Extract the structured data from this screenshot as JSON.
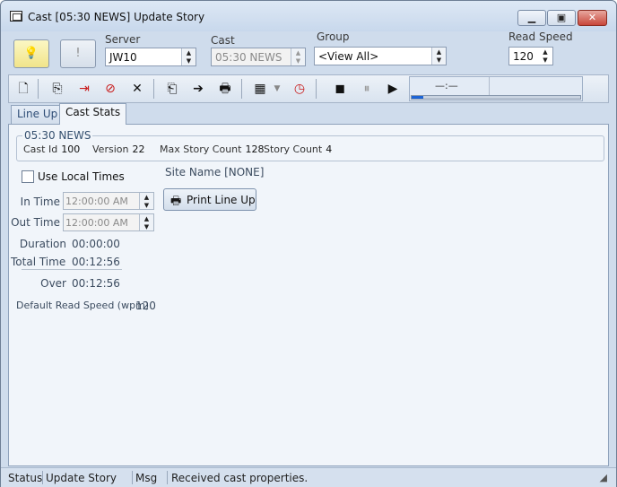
{
  "window": {
    "title": "Cast [05:30 NEWS] Update Story"
  },
  "header": {
    "server_label": "Server",
    "server_value": "JW10",
    "cast_label": "Cast",
    "cast_value": "05:30 NEWS",
    "group_label": "Group",
    "group_value": "<View All>",
    "read_speed_label": "Read Speed",
    "read_speed_value": "120"
  },
  "toolbar": {
    "icons": [
      "new-document-icon",
      "copy-icon",
      "move-out-icon",
      "remove-icon",
      "delete-icon",
      "paste-icon",
      "send-icon",
      "print-icon",
      "view-icon",
      "dropdown-icon",
      "timer-icon",
      "stop-icon",
      "pause-icon",
      "play-icon"
    ],
    "progress_label": "—:—",
    "progress_fraction": 0.07
  },
  "tabs": [
    "Line Up",
    "Cast Stats"
  ],
  "stats": {
    "group_title": "05:30 NEWS",
    "cast_id_label": "Cast Id",
    "cast_id": "100",
    "version_label": "Version",
    "version": "22",
    "max_story_label": "Max Story Count",
    "max_story": "128",
    "story_count_label": "Story Count",
    "story_count": "4"
  },
  "times": {
    "use_local_label": "Use Local Times",
    "in_label": "In Time",
    "in_value": "12:00:00 AM",
    "out_label": "Out Time",
    "out_value": "12:00:00 AM",
    "duration_label": "Duration",
    "duration_value": "00:00:00",
    "total_label": "Total Time",
    "total_value": "00:12:56",
    "over_label": "Over",
    "over_value": "00:12:56",
    "read_speed_label": "Default Read Speed (wpm)",
    "read_speed_value": "120"
  },
  "site": {
    "site_name": "Site Name [NONE]",
    "print_label": "Print Line Up"
  },
  "status": {
    "status_label": "Status",
    "status_value": "Update Story",
    "msg_label": "Msg",
    "msg_value": "Received cast properties."
  },
  "colors": {
    "accent": "#1c64d6",
    "frame": "#cfdcec",
    "panel": "#f1f5fa"
  }
}
